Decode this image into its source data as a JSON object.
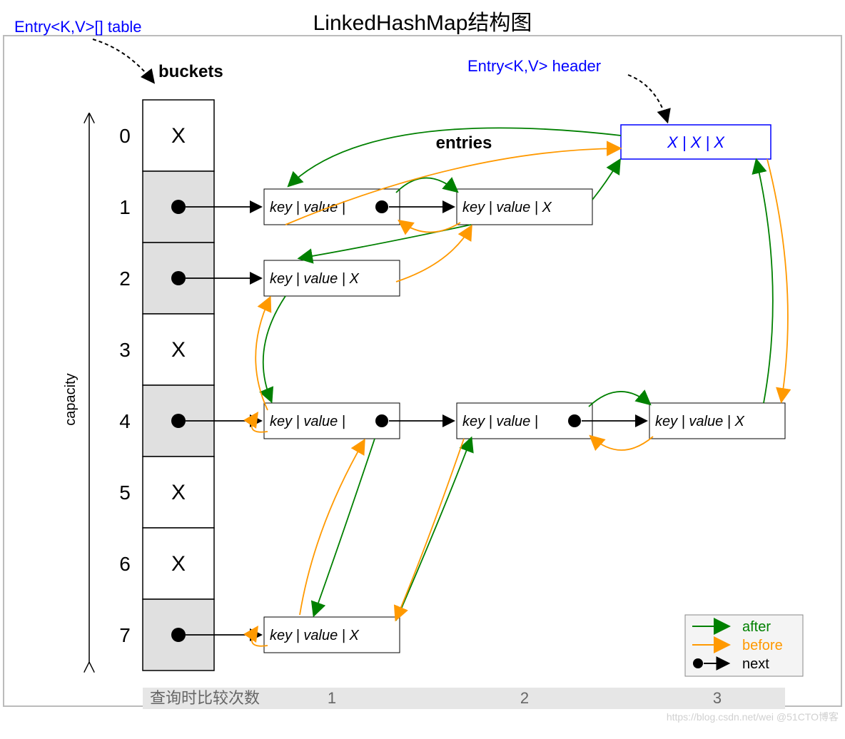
{
  "title": "LinkedHashMap结构图",
  "tableLabel": "Entry<K,V>[] table",
  "headerLabel": "Entry<K,V> header",
  "bucketsLabel": "buckets",
  "entriesLabel": "entries",
  "capacityLabel": "capacity",
  "indices": [
    "0",
    "1",
    "2",
    "3",
    "4",
    "5",
    "6",
    "7"
  ],
  "xMark": "X",
  "entryText": "key | value | ",
  "entryTextX": "key | value |  X",
  "headerBoxText": "X  |  X  |  X",
  "footerLabel": "查询时比较次数",
  "footerCols": [
    "1",
    "2",
    "3"
  ],
  "legend": {
    "after": "after",
    "before": "before",
    "next": "next"
  },
  "watermark": "https://blog.csdn.net/wei @51CTO博客",
  "filledRows": [
    1,
    2,
    4,
    7
  ],
  "colors": {
    "green": "#008000",
    "orange": "#ff9900",
    "blue": "#0000ff"
  },
  "chart_data": {
    "type": "diagram",
    "structure": "LinkedHashMap",
    "bucket_array_size": 8,
    "buckets": [
      {
        "index": 0,
        "empty": true
      },
      {
        "index": 1,
        "empty": false,
        "chain_length": 2
      },
      {
        "index": 2,
        "empty": false,
        "chain_length": 1
      },
      {
        "index": 3,
        "empty": true
      },
      {
        "index": 4,
        "empty": false,
        "chain_length": 3
      },
      {
        "index": 5,
        "empty": true
      },
      {
        "index": 6,
        "empty": true
      },
      {
        "index": 7,
        "empty": false,
        "chain_length": 1
      }
    ],
    "header_sentinel": "Entry<K,V> header (X|X|X)",
    "pointer_types": [
      "after (green)",
      "before (orange)",
      "next (black)"
    ],
    "comparison_counts": [
      1,
      2,
      3
    ]
  }
}
